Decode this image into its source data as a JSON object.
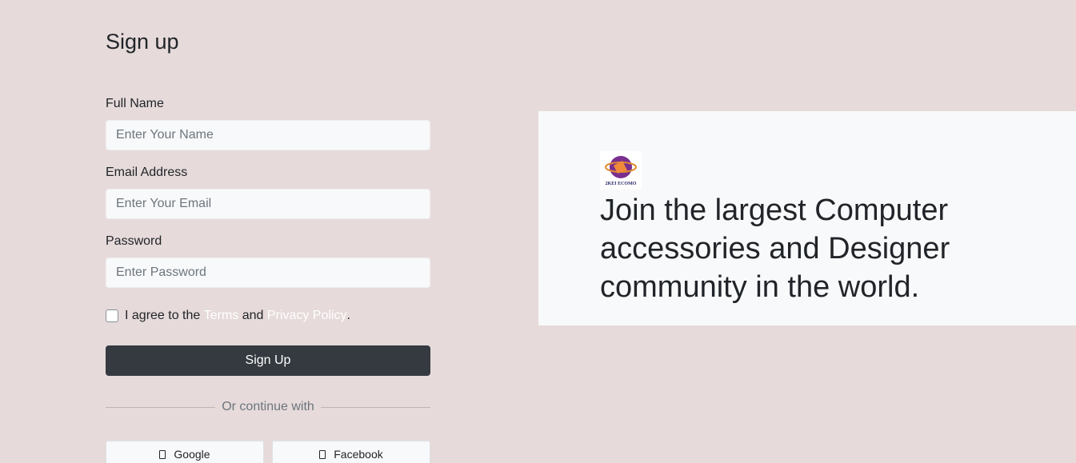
{
  "form": {
    "title": "Sign up",
    "full_name": {
      "label": "Full Name",
      "placeholder": "Enter Your Name"
    },
    "email": {
      "label": "Email Address",
      "placeholder": "Enter Your Email"
    },
    "password": {
      "label": "Password",
      "placeholder": "Enter Password"
    },
    "agree": {
      "prefix": "I agree to the ",
      "terms": "Terms",
      "middle": " and ",
      "privacy": "Privacy Policy",
      "suffix": "."
    },
    "submit_label": "Sign Up",
    "divider_text": "Or continue with",
    "social": [
      {
        "label": "Google",
        "icon": "google-icon"
      },
      {
        "label": "Facebook",
        "icon": "facebook-icon"
      }
    ]
  },
  "promo": {
    "logo_text": "2KEI ECOMO",
    "headline": "Join the largest Computer accessories and Designer community in the world."
  },
  "colors": {
    "background": "#e6dada",
    "panel": "#f8f9fa",
    "primary_button": "#343a40",
    "link": "#ffffff"
  }
}
